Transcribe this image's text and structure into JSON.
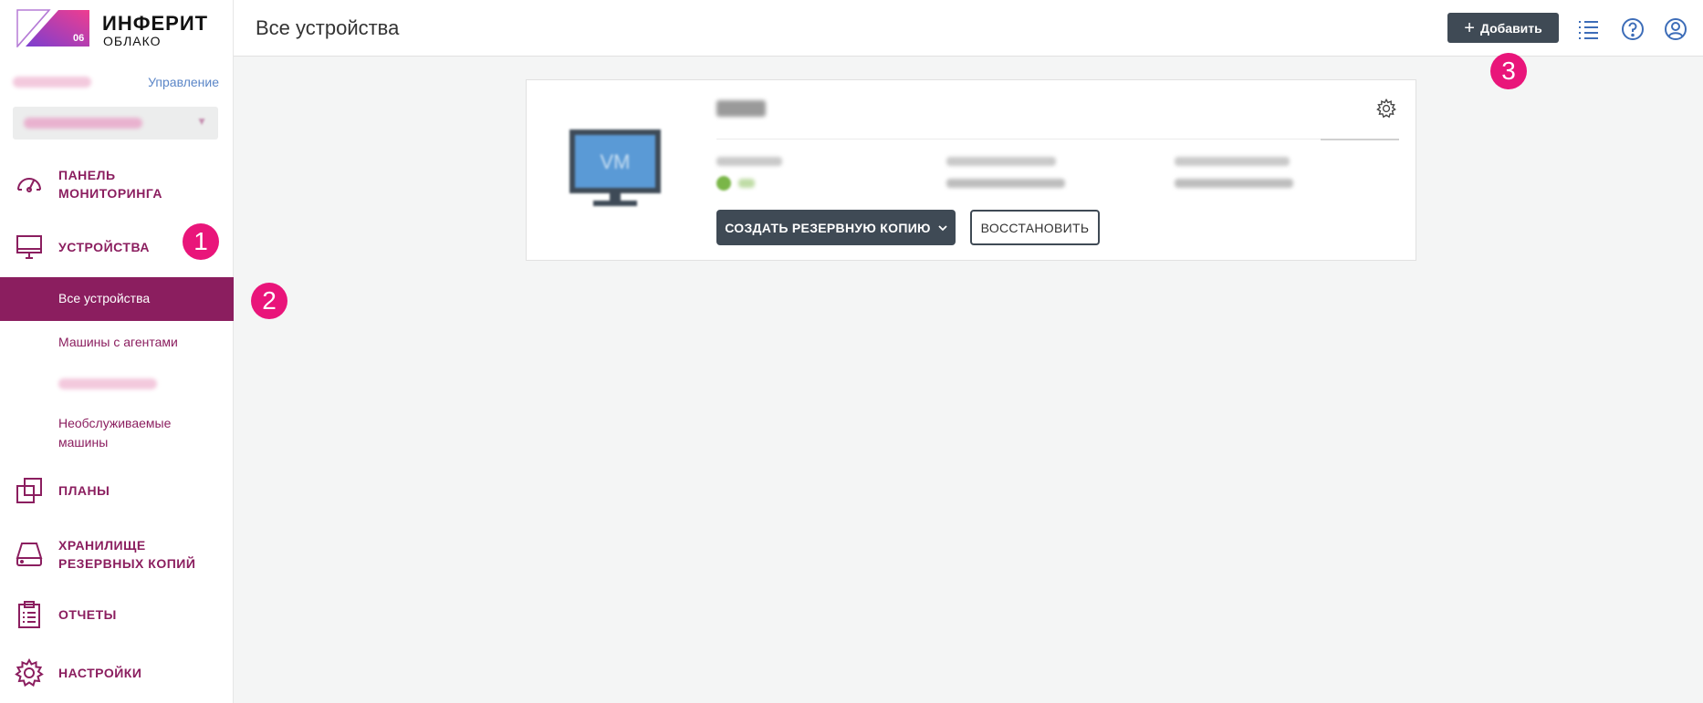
{
  "brand": {
    "name": "ИНФЕРИТ",
    "subtitle": "ОБЛАКО",
    "badge": "06",
    "accent_color": "#8b1e5f",
    "marker_color": "#e9157a"
  },
  "sidebar": {
    "manage_link": "Управление",
    "nav": [
      {
        "label": "ПАНЕЛЬ\nМОНИТОРИНГА",
        "icon": "gauge-icon"
      },
      {
        "label": "УСТРОЙСТВА",
        "icon": "monitor-icon"
      },
      {
        "label": "ПЛАНЫ",
        "icon": "plans-icon"
      },
      {
        "label": "ХРАНИЛИЩЕ\nРЕЗЕРВНЫХ КОПИЙ",
        "icon": "storage-icon"
      },
      {
        "label": "ОТЧЕТЫ",
        "icon": "clipboard-icon"
      },
      {
        "label": "НАСТРОЙКИ",
        "icon": "gear-icon"
      }
    ],
    "devices_sub": [
      {
        "label": "Все устройства",
        "active": true
      },
      {
        "label": "Машины с агентами"
      },
      {
        "label": "Необслуживаемые\nмашины"
      }
    ]
  },
  "header": {
    "title": "Все устройства",
    "add_label": "Добавить"
  },
  "device_card": {
    "vm_label": "VM",
    "backup_button": "СОЗДАТЬ РЕЗЕРВНУЮ КОПИЮ",
    "restore_button": "ВОССТАНОВИТЬ"
  },
  "markers": [
    "1",
    "2",
    "3"
  ]
}
